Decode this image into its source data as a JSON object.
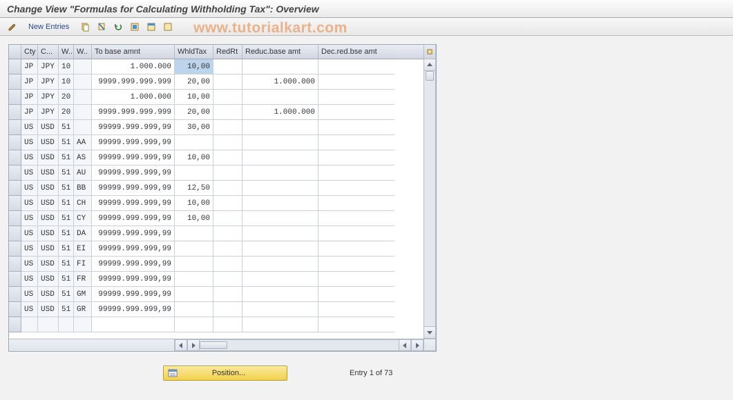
{
  "title": "Change View \"Formulas for Calculating Withholding Tax\": Overview",
  "watermark": "www.tutorialkart.com",
  "toolbar": {
    "new_entries_label": "New Entries"
  },
  "columns": {
    "cty": "Cty",
    "crcy": "C...",
    "w1": "W..",
    "w2": "W..",
    "to_base": "To base amnt",
    "whld": "WhldTax",
    "redrt": "RedRt",
    "reduc_base": "Reduc.base amt",
    "dec_red": "Dec.red.bse amt"
  },
  "rows": [
    {
      "cty": "JP",
      "crcy": "JPY",
      "w1": "10",
      "w2": "",
      "base": "1.000.000",
      "whld": "10,00",
      "redrt": "",
      "rbase": "",
      "dec": ""
    },
    {
      "cty": "JP",
      "crcy": "JPY",
      "w1": "10",
      "w2": "",
      "base": "9999.999.999.999",
      "whld": "20,00",
      "redrt": "",
      "rbase": "1.000.000",
      "dec": ""
    },
    {
      "cty": "JP",
      "crcy": "JPY",
      "w1": "20",
      "w2": "",
      "base": "1.000.000",
      "whld": "10,00",
      "redrt": "",
      "rbase": "",
      "dec": ""
    },
    {
      "cty": "JP",
      "crcy": "JPY",
      "w1": "20",
      "w2": "",
      "base": "9999.999.999.999",
      "whld": "20,00",
      "redrt": "",
      "rbase": "1.000.000",
      "dec": ""
    },
    {
      "cty": "US",
      "crcy": "USD",
      "w1": "51",
      "w2": "",
      "base": "99999.999.999,99",
      "whld": "30,00",
      "redrt": "",
      "rbase": "",
      "dec": ""
    },
    {
      "cty": "US",
      "crcy": "USD",
      "w1": "51",
      "w2": "AA",
      "base": "99999.999.999,99",
      "whld": "",
      "redrt": "",
      "rbase": "",
      "dec": ""
    },
    {
      "cty": "US",
      "crcy": "USD",
      "w1": "51",
      "w2": "AS",
      "base": "99999.999.999,99",
      "whld": "10,00",
      "redrt": "",
      "rbase": "",
      "dec": ""
    },
    {
      "cty": "US",
      "crcy": "USD",
      "w1": "51",
      "w2": "AU",
      "base": "99999.999.999,99",
      "whld": "",
      "redrt": "",
      "rbase": "",
      "dec": ""
    },
    {
      "cty": "US",
      "crcy": "USD",
      "w1": "51",
      "w2": "BB",
      "base": "99999.999.999,99",
      "whld": "12,50",
      "redrt": "",
      "rbase": "",
      "dec": ""
    },
    {
      "cty": "US",
      "crcy": "USD",
      "w1": "51",
      "w2": "CH",
      "base": "99999.999.999,99",
      "whld": "10,00",
      "redrt": "",
      "rbase": "",
      "dec": ""
    },
    {
      "cty": "US",
      "crcy": "USD",
      "w1": "51",
      "w2": "CY",
      "base": "99999.999.999,99",
      "whld": "10,00",
      "redrt": "",
      "rbase": "",
      "dec": ""
    },
    {
      "cty": "US",
      "crcy": "USD",
      "w1": "51",
      "w2": "DA",
      "base": "99999.999.999,99",
      "whld": "",
      "redrt": "",
      "rbase": "",
      "dec": ""
    },
    {
      "cty": "US",
      "crcy": "USD",
      "w1": "51",
      "w2": "EI",
      "base": "99999.999.999,99",
      "whld": "",
      "redrt": "",
      "rbase": "",
      "dec": ""
    },
    {
      "cty": "US",
      "crcy": "USD",
      "w1": "51",
      "w2": "FI",
      "base": "99999.999.999,99",
      "whld": "",
      "redrt": "",
      "rbase": "",
      "dec": ""
    },
    {
      "cty": "US",
      "crcy": "USD",
      "w1": "51",
      "w2": "FR",
      "base": "99999.999.999,99",
      "whld": "",
      "redrt": "",
      "rbase": "",
      "dec": ""
    },
    {
      "cty": "US",
      "crcy": "USD",
      "w1": "51",
      "w2": "GM",
      "base": "99999.999.999,99",
      "whld": "",
      "redrt": "",
      "rbase": "",
      "dec": ""
    },
    {
      "cty": "US",
      "crcy": "USD",
      "w1": "51",
      "w2": "GR",
      "base": "99999.999.999,99",
      "whld": "",
      "redrt": "",
      "rbase": "",
      "dec": ""
    }
  ],
  "selected_cell": {
    "row": 0,
    "field": "whld"
  },
  "footer": {
    "position_label": "Position...",
    "entry_text": "Entry 1 of 73"
  }
}
